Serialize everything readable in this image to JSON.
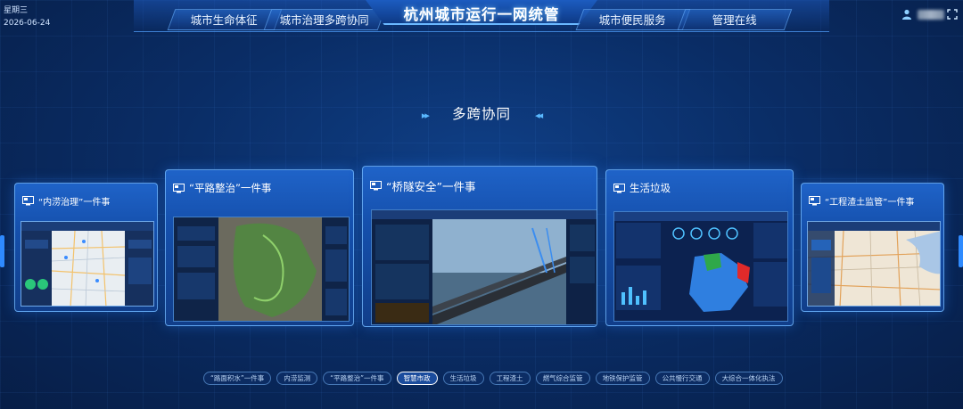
{
  "header": {
    "weekday": "星期三",
    "date": "2026-06-24",
    "title": "杭州城市运行一网统管",
    "nav_left": [
      "城市生命体征",
      "城市治理多跨协同"
    ],
    "nav_right": [
      "城市便民服务",
      "管理在线"
    ],
    "icons": {
      "user": "user-icon",
      "expand": "fullscreen-icon"
    }
  },
  "section": {
    "title": "多跨协同"
  },
  "cards": [
    {
      "title": "“内涝治理”一件事"
    },
    {
      "title": "“平路整治”一件事"
    },
    {
      "title": "“桥隧安全”一件事"
    },
    {
      "title": "生活垃圾"
    },
    {
      "title": "“工程渣土监管”一件事"
    }
  ],
  "pills": [
    "“路面积水”一件事",
    "内涝监测",
    "“平路整治”一件事",
    "智慧市政",
    "生活垃圾",
    "工程渣土",
    "燃气综合监管",
    "地铁保护监管",
    "公共慢行交通",
    "大综合一体化执法"
  ],
  "active_pill_index": 3,
  "colors": {
    "accent": "#2f8bff",
    "card_top": "#1f63c8",
    "green_map": "#2fa84a",
    "red_map": "#e02a2a"
  }
}
